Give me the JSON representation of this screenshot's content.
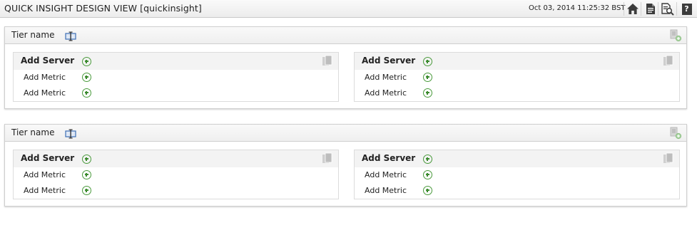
{
  "header": {
    "title": "QUICK INSIGHT DESIGN VIEW [quickinsight]",
    "timestamp": "Oct 03, 2014 11:25:32 BST",
    "icons": [
      "home-icon",
      "document-icon",
      "search-report-icon",
      "help-icon"
    ],
    "help_label": "?"
  },
  "tiers": [
    {
      "name": "Tier name",
      "servers": [
        {
          "label": "Add Server",
          "metrics": [
            "Add Metric",
            "Add Metric"
          ]
        },
        {
          "label": "Add Server",
          "metrics": [
            "Add Metric",
            "Add Metric"
          ]
        }
      ]
    },
    {
      "name": "Tier name",
      "servers": [
        {
          "label": "Add Server",
          "metrics": [
            "Add Metric",
            "Add Metric"
          ]
        },
        {
          "label": "Add Server",
          "metrics": [
            "Add Metric",
            "Add Metric"
          ]
        }
      ]
    }
  ],
  "colors": {
    "add_icon_green": "#4a9a3c",
    "edit_icon_blue": "#3d6fb5",
    "panel_border": "#cfcfcf"
  }
}
